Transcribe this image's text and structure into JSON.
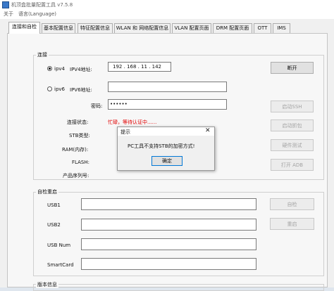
{
  "window": {
    "title": "机顶盒批量配置工具 v7.5.8"
  },
  "menu": [
    "关于",
    "语言(Language)"
  ],
  "tabs": [
    "连接和自检",
    "基本配置信息",
    "特征配置信息",
    "WLAN 和 网络配置信息",
    "VLAN 配置页面",
    "DRM 配置页面",
    "OTT",
    "IMS"
  ],
  "connect": {
    "legend": "连接",
    "ipv4_label": "ipv4",
    "ipv4_addr_label": "IPV4地址:",
    "ipv4_value": "192 . 168 . 11 . 142",
    "ipv6_label": "ipv6",
    "ipv6_addr_label": "IPV6地址:",
    "ipv6_value": "",
    "password_label": "密码:",
    "password_value": "••••••",
    "status_label": "连接状态:",
    "status_value": "忙碌，等待认证中......",
    "stb_type_label": "STB类型:",
    "ram_label": "RAM(内存):",
    "flash_label": "FLASH:",
    "serial_label": "产品序列号:",
    "buttons": {
      "disconnect": "断开",
      "ssh": "启动SSH",
      "capture": "启动抓包",
      "hw_test": "硬件测试",
      "adb": "打开 ADB"
    }
  },
  "selftest": {
    "legend": "自检重启",
    "usb1_label": "USB1",
    "usb2_label": "USB2",
    "usbnum_label": "USB Num",
    "smartcard_label": "SmartCard",
    "buttons": {
      "selfcheck": "自检",
      "reboot": "重启"
    }
  },
  "bottom_legend": "版本信息",
  "dialog": {
    "title": "提示",
    "message": "PC工具不支持STB的加密方式!",
    "ok": "确定"
  }
}
